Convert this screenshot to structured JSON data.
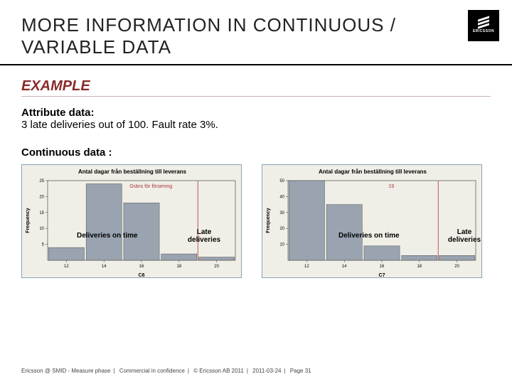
{
  "brand": "ERICSSON",
  "title": "MORE INFORMATION IN CONTINUOUS / VARIABLE DATA",
  "example_heading": "EXAMPLE",
  "attribute": {
    "label": "Attribute data:",
    "text": "3 late deliveries out of 100. Fault rate 3%."
  },
  "continuous_label": "Continuous data :",
  "overlays": {
    "on_time": "Deliveries on time",
    "late": "Late deliveries"
  },
  "footer": {
    "p1": "Ericsson @ SMID - Measure phase",
    "p2": "Commercial in confidence",
    "p3": "© Ericsson AB 2011",
    "p4": "2011-03-24",
    "p5": "Page 31"
  },
  "chart_data": [
    {
      "type": "bar",
      "title": "Antal dagar från beställning till leverans",
      "subtitle": "Gräns för försening",
      "xlabel": "C6",
      "ylabel": "Frequency",
      "categories": [
        12,
        14,
        16,
        18,
        20
      ],
      "values": [
        4,
        24,
        18,
        2,
        1
      ],
      "ylim": [
        0,
        25
      ],
      "yticks": [
        5,
        10,
        15,
        20,
        25
      ],
      "ref_line_x": 19
    },
    {
      "type": "bar",
      "title": "Antal dagar från beställning till leverans",
      "subtitle": "19",
      "xlabel": "C7",
      "ylabel": "Frequency",
      "categories": [
        12,
        14,
        16,
        18,
        20
      ],
      "values": [
        50,
        35,
        9,
        3,
        3
      ],
      "ylim": [
        0,
        50
      ],
      "yticks": [
        10,
        20,
        30,
        40,
        50
      ],
      "ref_line_x": 19
    }
  ]
}
